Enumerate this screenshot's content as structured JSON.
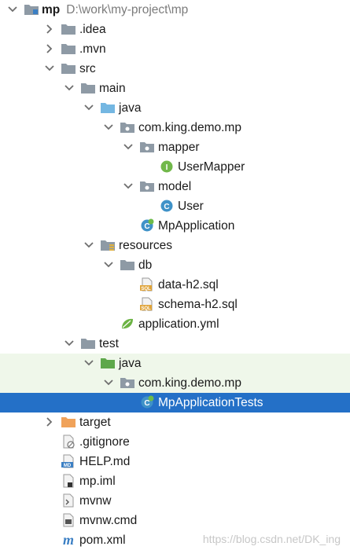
{
  "project": {
    "name": "mp",
    "path": "D:\\work\\my-project\\mp"
  },
  "colors": {
    "selection": "#2470c7",
    "test_background": "#eff7ea",
    "folder": "#8e9aa5",
    "source_folder": "#74b7e2",
    "test_folder": "#5ea84b",
    "excluded_folder": "#f0a25a"
  },
  "rows": [
    {
      "label": "mp",
      "path": "D:\\work\\my-project\\mp",
      "icon": "module-folder-icon",
      "arrow": "down",
      "indent": 0,
      "bold": true
    },
    {
      "label": ".idea",
      "icon": "folder-icon",
      "arrow": "right",
      "indent": 1
    },
    {
      "label": ".mvn",
      "icon": "folder-icon",
      "arrow": "right",
      "indent": 1
    },
    {
      "label": "src",
      "icon": "folder-icon",
      "arrow": "down",
      "indent": 1
    },
    {
      "label": "main",
      "icon": "folder-icon",
      "arrow": "down",
      "indent": 2
    },
    {
      "label": "java",
      "icon": "source-folder-icon",
      "arrow": "down",
      "indent": 3
    },
    {
      "label": "com.king.demo.mp",
      "icon": "package-icon",
      "arrow": "down",
      "indent": 4
    },
    {
      "label": "mapper",
      "icon": "package-icon",
      "arrow": "down",
      "indent": 5
    },
    {
      "label": "UserMapper",
      "icon": "interface-icon",
      "arrow": "none",
      "indent": 6
    },
    {
      "label": "model",
      "icon": "package-icon",
      "arrow": "down",
      "indent": 5
    },
    {
      "label": "User",
      "icon": "class-icon",
      "arrow": "none",
      "indent": 6
    },
    {
      "label": "MpApplication",
      "icon": "spring-boot-class-icon",
      "arrow": "none",
      "indent": 5
    },
    {
      "label": "resources",
      "icon": "resources-folder-icon",
      "arrow": "down",
      "indent": 3
    },
    {
      "label": "db",
      "icon": "folder-icon",
      "arrow": "down",
      "indent": 4
    },
    {
      "label": "data-h2.sql",
      "icon": "sql-file-icon",
      "arrow": "none",
      "indent": 5
    },
    {
      "label": "schema-h2.sql",
      "icon": "sql-file-icon",
      "arrow": "none",
      "indent": 5
    },
    {
      "label": "application.yml",
      "icon": "spring-yml-icon",
      "arrow": "none",
      "indent": 4
    },
    {
      "label": "test",
      "icon": "folder-icon",
      "arrow": "down",
      "indent": 2
    },
    {
      "label": "java",
      "icon": "test-folder-icon",
      "arrow": "down",
      "indent": 3,
      "bg": "green"
    },
    {
      "label": "com.king.demo.mp",
      "icon": "package-icon",
      "arrow": "down",
      "indent": 4,
      "bg": "green"
    },
    {
      "label": "MpApplicationTests",
      "icon": "spring-test-class-icon",
      "arrow": "none",
      "indent": 5,
      "bg": "selected"
    },
    {
      "label": "target",
      "icon": "excluded-folder-icon",
      "arrow": "right",
      "indent": 1
    },
    {
      "label": ".gitignore",
      "icon": "ignore-file-icon",
      "arrow": "none",
      "indent": 1
    },
    {
      "label": "HELP.md",
      "icon": "markdown-file-icon",
      "arrow": "none",
      "indent": 1
    },
    {
      "label": "mp.iml",
      "icon": "iml-file-icon",
      "arrow": "none",
      "indent": 1
    },
    {
      "label": "mvnw",
      "icon": "script-file-icon",
      "arrow": "none",
      "indent": 1
    },
    {
      "label": "mvnw.cmd",
      "icon": "cmd-file-icon",
      "arrow": "none",
      "indent": 1
    },
    {
      "label": "pom.xml",
      "icon": "maven-pom-icon",
      "arrow": "none",
      "indent": 1
    }
  ],
  "watermark": "https://blog.csdn.net/DK_ing"
}
